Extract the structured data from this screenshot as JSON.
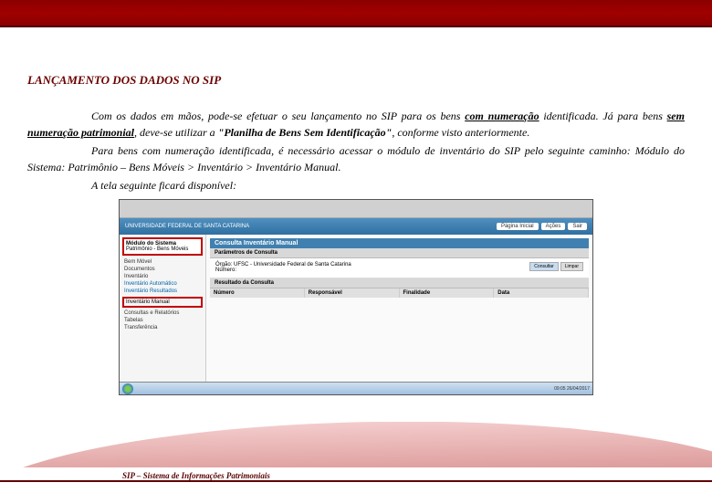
{
  "heading": "LANÇAMENTO DOS DADOS NO SIP",
  "p1a": "Com os dados em mãos, pode-se efetuar o seu lançamento no SIP para os bens ",
  "p1b": "com numeração",
  "p1c": " identificada. Já para bens ",
  "p1d": "sem numeração patrimonial",
  "p1e": ", deve-se utilizar a ",
  "p1f": "\"Planilha de Bens Sem Identificação\"",
  "p1g": ", conforme visto anteriormente.",
  "p2": "Para bens com numeração identificada, é necessário acessar o módulo de inventário do SIP pelo seguinte caminho: Módulo do Sistema: Patrimônio – Bens Móveis > Inventário > Inventário Manual.",
  "p3": "A tela seguinte ficará disponível:",
  "screenshot": {
    "header_org": "UNIVERSIDADE FEDERAL DE SANTA CATARINA",
    "header_btns": [
      "Página Inicial",
      "Ações",
      "Sair"
    ],
    "sidebar_module_title": "Módulo do Sistema",
    "sidebar_module_value": "Patrimônio - Bens Móveis",
    "sidebar_items": [
      "Bem Móvel",
      "Documentos",
      "Inventário",
      "Inventário Automático",
      "Inventário Resultados"
    ],
    "sidebar_highlight": "Inventário Manual",
    "sidebar_items2": "Consultas e Relatórios",
    "sidebar_items3": "Tabelas",
    "sidebar_items4": "Transferência",
    "panel_title": "Consulta Inventário Manual",
    "panel_params": "Parâmetros de Consulta",
    "param_label1": "Órgão:",
    "param_value1": "UFSC - Universidade Federal de Santa Catarina",
    "param_label2": "Número:",
    "btn_consultar": "Consultar",
    "btn_limpar": "Limpar",
    "panel_result": "Resultado da Consulta",
    "cols": [
      "Número",
      "Responsável",
      "Finalidade",
      "Data"
    ],
    "taskbar_time": "09:05 26/04/2017"
  },
  "footer": "SIP – Sistema de Informações Patrimoniais"
}
